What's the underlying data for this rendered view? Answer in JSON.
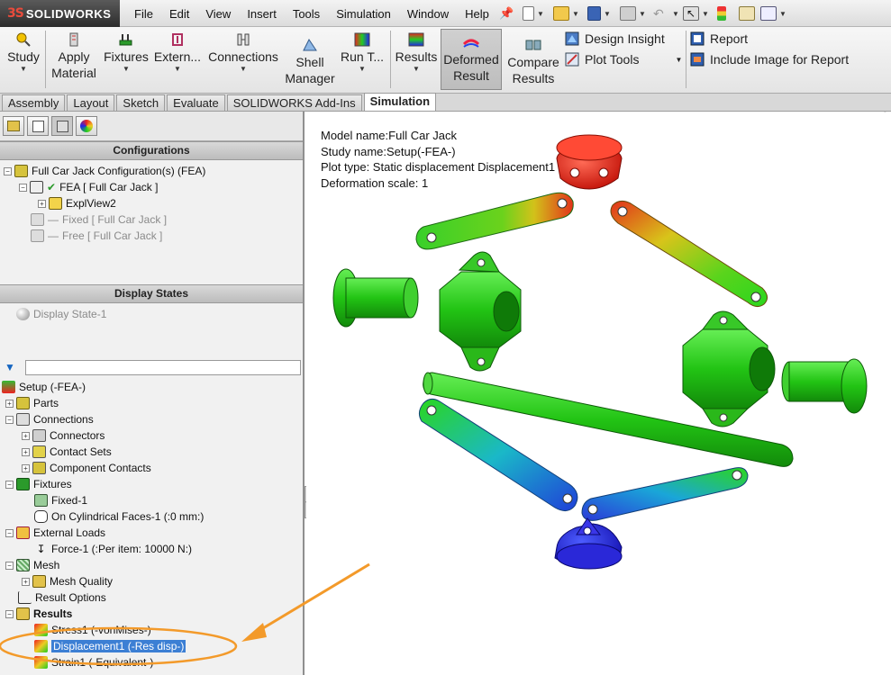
{
  "app": {
    "logo_mark": "3S",
    "brand": "SOLIDWORKS"
  },
  "menu": [
    "File",
    "Edit",
    "View",
    "Insert",
    "Tools",
    "Simulation",
    "Window",
    "Help"
  ],
  "quick_access_icons": [
    "new-document-icon",
    "open-folder-icon",
    "save-icon",
    "print-icon",
    "undo-icon",
    "select-icon",
    "rebuild-icon",
    "file-properties-icon",
    "options-icon"
  ],
  "ribbon": {
    "study": "Study",
    "apply_material_1": "Apply",
    "apply_material_2": "Material",
    "fixtures": "Fixtures",
    "external": "Extern...",
    "connections": "Connections",
    "shell_1": "Shell",
    "shell_2": "Manager",
    "run": "Run T...",
    "results": "Results",
    "deformed_1": "Deformed",
    "deformed_2": "Result",
    "compare_1": "Compare",
    "compare_2": "Results",
    "design_insight": "Design Insight",
    "plot_tools": "Plot Tools",
    "report": "Report",
    "include_image": "Include Image for Report"
  },
  "tabs": [
    "Assembly",
    "Layout",
    "Sketch",
    "Evaluate",
    "SOLIDWORKS Add-Ins",
    "Simulation"
  ],
  "active_tab": "Simulation",
  "configurations": {
    "title": "Configurations",
    "root": "Full Car Jack Configuration(s)  (FEA)",
    "fea": "FEA [ Full Car Jack ]",
    "explview": "ExplView2",
    "fixed": "Fixed [ Full Car Jack ]",
    "free": "Free [ Full Car Jack ]"
  },
  "display_states": {
    "title": "Display States",
    "item": "Display State-1"
  },
  "study_tree": {
    "setup": "Setup (-FEA-)",
    "parts": "Parts",
    "connections": "Connections",
    "connectors": "Connectors",
    "contact_sets": "Contact Sets",
    "component_contacts": "Component Contacts",
    "fixtures": "Fixtures",
    "fixed1": "Fixed-1",
    "on_cyl": "On Cylindrical Faces-1 (:0 mm:)",
    "external_loads": "External Loads",
    "force1": "Force-1 (:Per item: 10000 N:)",
    "mesh": "Mesh",
    "mesh_quality": "Mesh Quality",
    "result_options": "Result Options",
    "results": "Results",
    "stress1": "Stress1 (-vonMises-)",
    "displacement1": "Displacement1 (-Res disp-)",
    "strain1": "Strain1 (-Equivalent-)"
  },
  "plot_info": {
    "model_name": "Model name:Full Car Jack",
    "study_name": "Study name:Setup(-FEA-)",
    "plot_type": "Plot type: Static displacement Displacement1",
    "deformation_scale": "Deformation scale: 1"
  },
  "colors": {
    "max_red": "#e8261a",
    "mid_yellow": "#e8d21a",
    "mid_green": "#2bd61e",
    "low_cyan": "#1a9ee8",
    "min_blue": "#1f1fd8",
    "highlight_orange": "#f39a2a",
    "selection_blue": "#3c7fd4"
  }
}
